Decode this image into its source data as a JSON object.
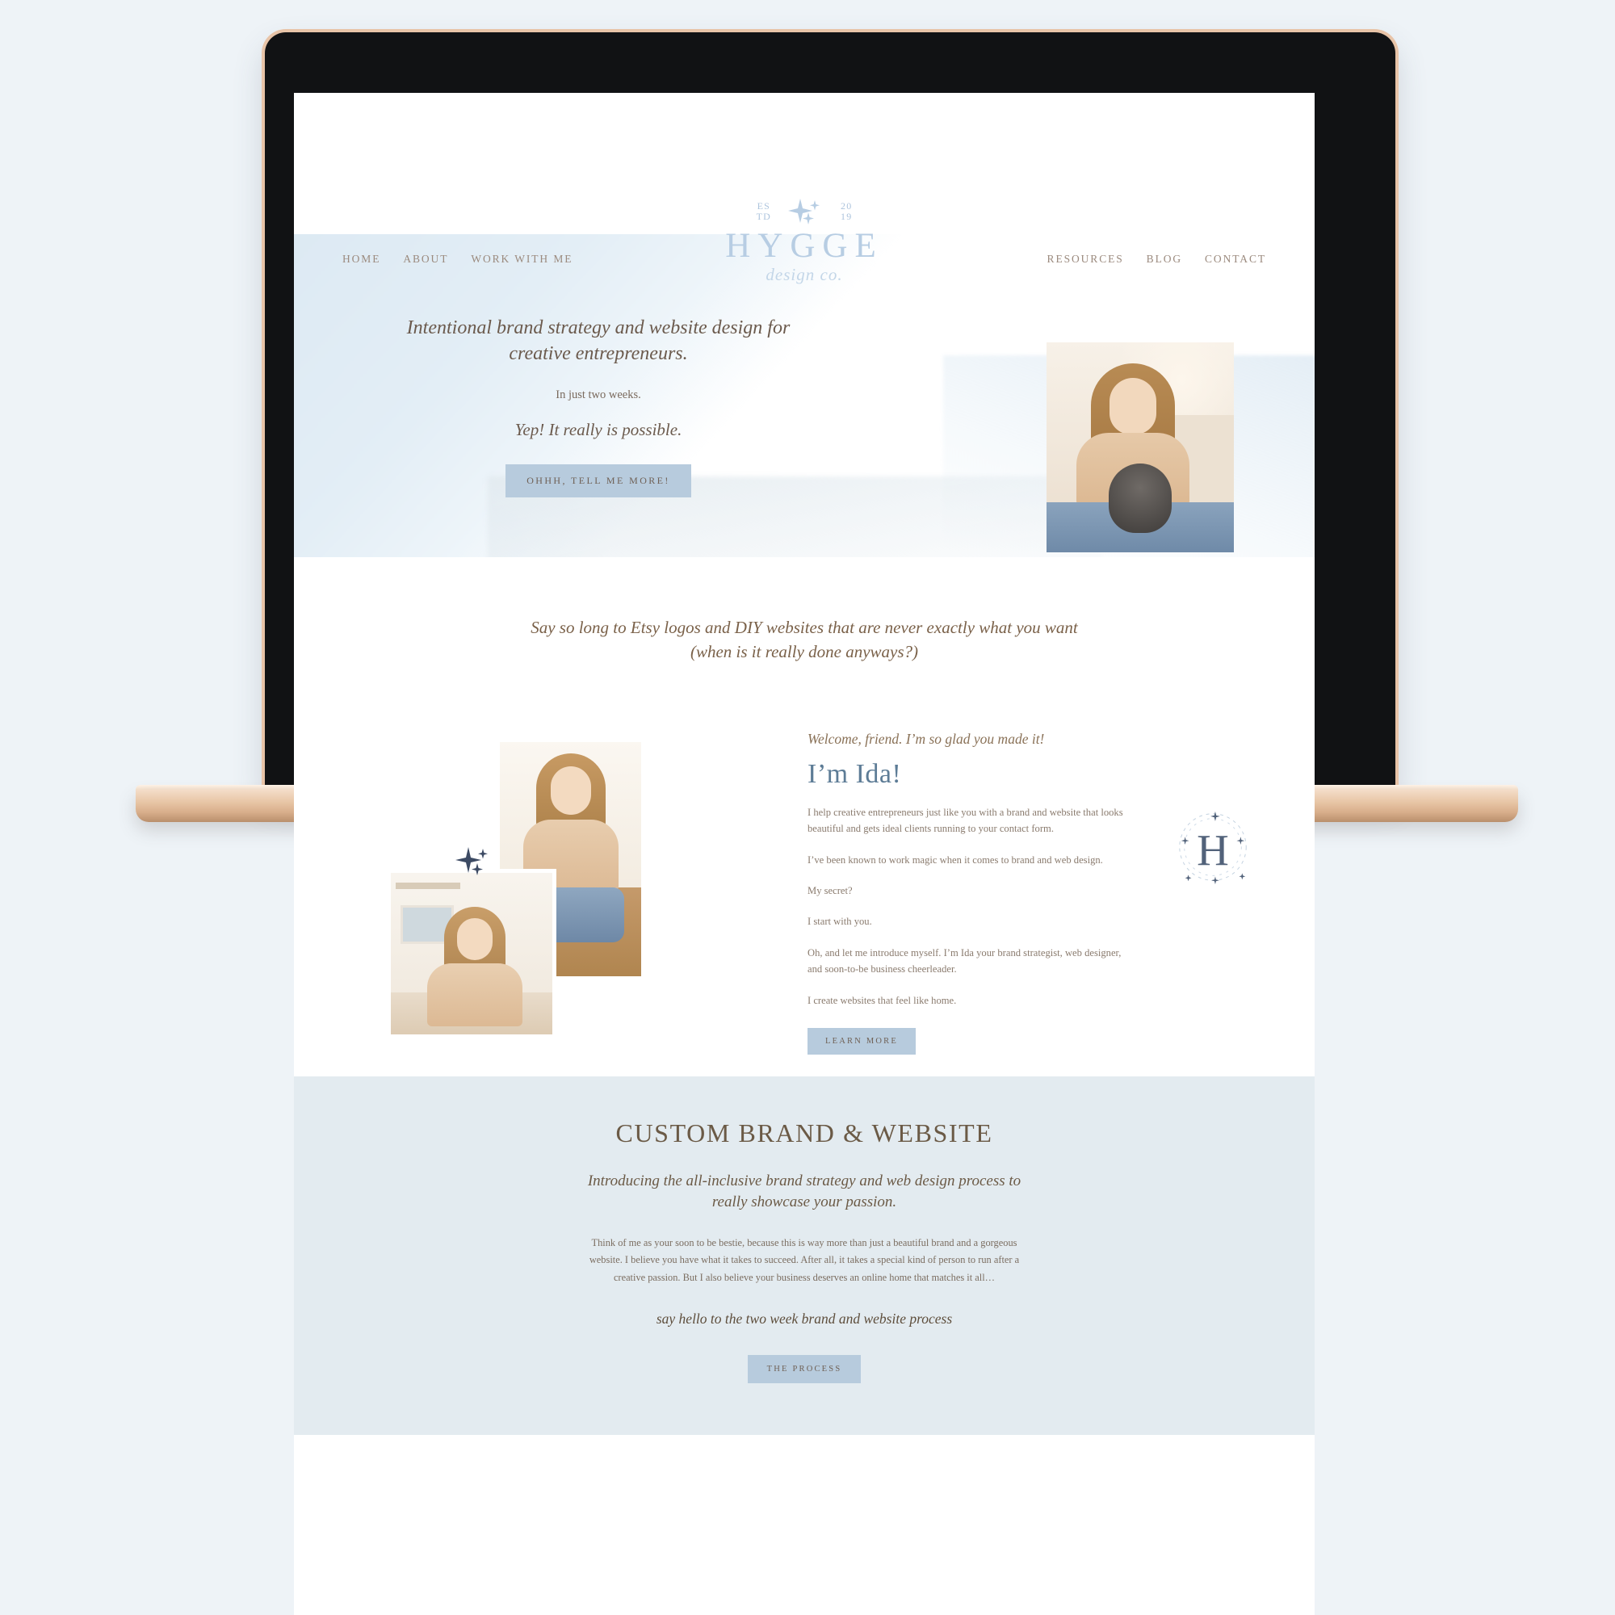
{
  "brand": {
    "logo_estd_line1": "ES",
    "logo_estd_line2": "TD",
    "logo_year_line1": "20",
    "logo_year_line2": "19",
    "logo_wordmark": "HYGGE",
    "logo_script": "design co.",
    "monogram_letter": "H"
  },
  "colors": {
    "page_background": "#eef3f7",
    "accent_blue": "#b7cbdd",
    "section_blue": "#e3ebf0",
    "logo_blue": "#b7cde3",
    "heading_blue": "#5d7c96",
    "text_brown": "#7a6a5d",
    "nav_brown": "#9b8a7e",
    "laptop_gold": "#e8c6a6"
  },
  "nav": {
    "left_items": [
      {
        "label": "HOME"
      },
      {
        "label": "ABOUT"
      },
      {
        "label": "WORK WITH ME"
      }
    ],
    "right_items": [
      {
        "label": "RESOURCES"
      },
      {
        "label": "BLOG"
      },
      {
        "label": "CONTACT"
      }
    ]
  },
  "hero": {
    "headline": "Intentional brand strategy and website design for creative entrepreneurs.",
    "subline": "In just two weeks.",
    "emphasis": "Yep! It really is possible.",
    "cta_label": "OHHH, TELL ME MORE!"
  },
  "tagline_section": {
    "text": "Say so long to Etsy logos and DIY websites that are never exactly what you want (when is it really done anyways?)"
  },
  "about": {
    "kicker": "Welcome, friend. I’m so glad you made it!",
    "heading": "I’m Ida!",
    "paragraphs": [
      "I help creative entrepreneurs just like you with a brand and website that looks beautiful and gets ideal clients running to your contact form.",
      "I’ve been known to work magic when it comes to brand and web design.",
      "My secret?",
      "I start with you.",
      "Oh, and let me introduce myself. I’m Ida your brand strategist, web designer, and soon-to-be business cheerleader.",
      "I create websites that feel like home."
    ],
    "cta_label": "LEARN MORE"
  },
  "brand_section": {
    "heading": "CUSTOM BRAND & WEBSITE",
    "subheading": "Introducing the all-inclusive brand strategy and web design process to really showcase your passion.",
    "body": "Think of me as your soon to be bestie, because this is way more than just a beautiful brand and a gorgeous website. I believe you have what it takes to succeed. After all, it takes a special kind of person to run after a creative passion. But I also believe your business deserves an online home that matches it all…",
    "hello_line": "say hello to the two week brand and website process",
    "cta_label": "THE PROCESS"
  }
}
